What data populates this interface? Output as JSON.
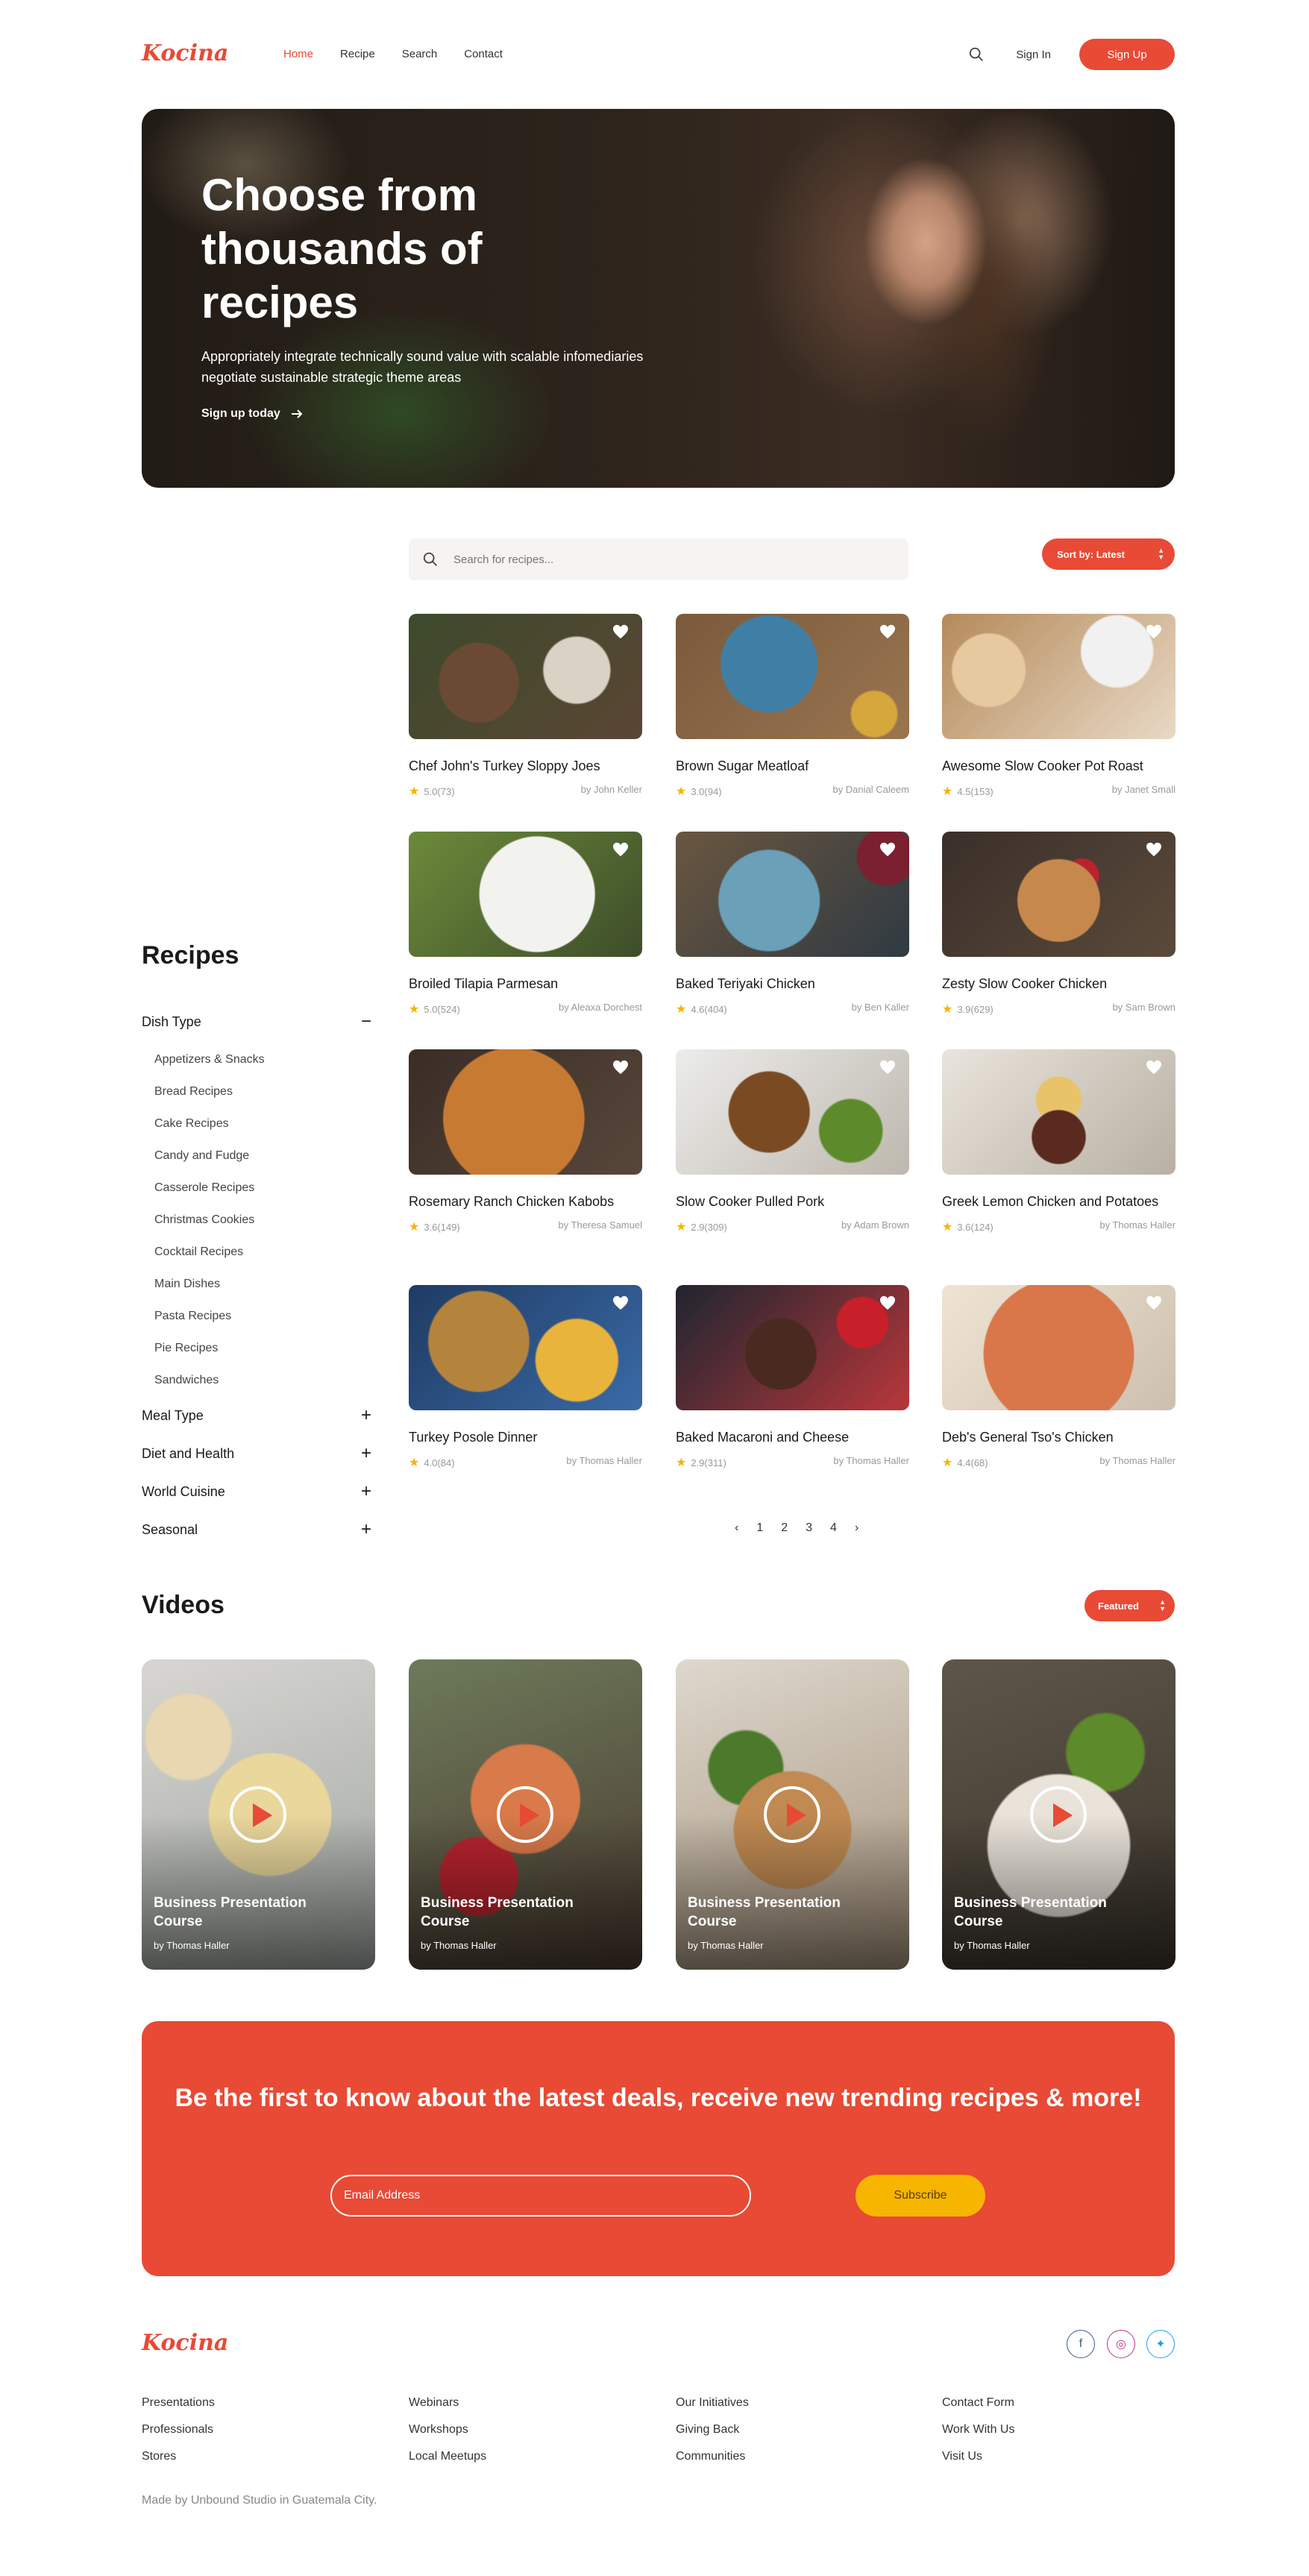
{
  "brand": {
    "logo": "Kocina",
    "accent": "#e84a35",
    "yellow": "#f7b500"
  },
  "nav": {
    "links": [
      {
        "label": "Home",
        "active": true
      },
      {
        "label": "Recipe",
        "active": false
      },
      {
        "label": "Search",
        "active": false
      },
      {
        "label": "Contact",
        "active": false
      }
    ],
    "sign_in": "Sign In",
    "sign_up": "Sign Up",
    "search_icon": "search-icon"
  },
  "hero": {
    "title": "Choose from thousands of recipes",
    "subtitle": "Appropriately integrate technically sound value with scalable infomediaries negotiate sustainable strategic theme areas",
    "cta": "Sign up today"
  },
  "search": {
    "placeholder": "Search for recipes..."
  },
  "sort": {
    "label": "Sort by: Latest"
  },
  "sidebar": {
    "title": "Recipes",
    "groups": [
      {
        "label": "Dish Type",
        "expanded": true,
        "toggle": "−",
        "items": [
          "Appetizers & Snacks",
          "Bread Recipes",
          "Cake Recipes",
          "Candy and Fudge",
          "Casserole Recipes",
          "Christmas Cookies",
          "Cocktail Recipes",
          "Main Dishes",
          "Pasta Recipes",
          "Pie Recipes",
          "Sandwiches"
        ]
      },
      {
        "label": "Meal Type",
        "expanded": false,
        "toggle": "+"
      },
      {
        "label": "Diet and Health",
        "expanded": false,
        "toggle": "+"
      },
      {
        "label": "World Cuisine",
        "expanded": false,
        "toggle": "+"
      },
      {
        "label": "Seasonal",
        "expanded": false,
        "toggle": "+"
      }
    ]
  },
  "recipes": [
    {
      "title": "Chef John's Turkey Sloppy Joes",
      "rating": "5.0(73)",
      "author": "by John Keller"
    },
    {
      "title": "Brown Sugar Meatloaf",
      "rating": "3.0(94)",
      "author": "by Danial Caleem"
    },
    {
      "title": "Awesome Slow Cooker Pot Roast",
      "rating": "4.5(153)",
      "author": "by Janet Small"
    },
    {
      "title": "Broiled Tilapia Parmesan",
      "rating": "5.0(524)",
      "author": "by Aleaxa Dorchest"
    },
    {
      "title": "Baked Teriyaki Chicken",
      "rating": "4.6(404)",
      "author": "by Ben Kaller"
    },
    {
      "title": "Zesty Slow Cooker Chicken",
      "rating": "3.9(629)",
      "author": "by Sam Brown"
    },
    {
      "title": "Rosemary Ranch Chicken Kabobs",
      "rating": "3.6(149)",
      "author": "by Theresa Samuel"
    },
    {
      "title": "Slow Cooker Pulled Pork",
      "rating": "2.9(309)",
      "author": "by Adam Brown"
    },
    {
      "title": "Greek Lemon Chicken and Potatoes",
      "rating": "3.6(124)",
      "author": "by Thomas Haller"
    },
    {
      "title": "Turkey Posole Dinner",
      "rating": "4.0(84)",
      "author": "by Thomas Haller"
    },
    {
      "title": "Baked Macaroni and Cheese",
      "rating": "2.9(311)",
      "author": "by Thomas Haller"
    },
    {
      "title": "Deb's General Tso's Chicken",
      "rating": "4.4(68)",
      "author": "by Thomas Haller"
    }
  ],
  "pagination": {
    "prev": "‹",
    "pages": [
      "1",
      "2",
      "3",
      "4"
    ],
    "next": "›"
  },
  "videos": {
    "title": "Videos",
    "filter": "Featured",
    "items": [
      {
        "title": "Business Presentation Course",
        "author": "by Thomas Haller"
      },
      {
        "title": "Business Presentation Course",
        "author": "by Thomas Haller"
      },
      {
        "title": "Business Presentation Course",
        "author": "by Thomas Haller"
      },
      {
        "title": "Business Presentation Course",
        "author": "by Thomas Haller"
      }
    ]
  },
  "newsletter": {
    "heading": "Be the first to know about the latest deals, receive new trending recipes & more!",
    "placeholder": "Email Address",
    "button": "Subscribe"
  },
  "footer": {
    "logo": "Kocina",
    "social": [
      {
        "icon": "facebook-icon",
        "glyph": "f",
        "color": "#3b5998"
      },
      {
        "icon": "instagram-icon",
        "glyph": "◎",
        "color": "#c13584"
      },
      {
        "icon": "twitter-icon",
        "glyph": "✦",
        "color": "#1da1f2"
      }
    ],
    "columns": [
      [
        "Presentations",
        "Professionals",
        "Stores"
      ],
      [
        "Webinars",
        "Workshops",
        "Local Meetups"
      ],
      [
        "Our Initiatives",
        "Giving Back",
        "Communities"
      ],
      [
        "Contact Form",
        "Work With Us",
        "Visit Us"
      ]
    ],
    "credit": "Made by Unbound Studio in Guatemala City."
  }
}
